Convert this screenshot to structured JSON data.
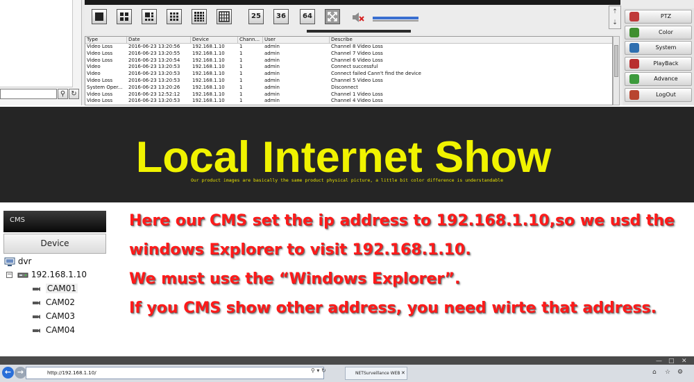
{
  "cms_screen": {
    "search": {
      "value": ""
    },
    "search_btn_icon": "magnifier-icon",
    "refresh_btn_icon": "refresh-icon",
    "layout_buttons": [
      "25",
      "36",
      "64"
    ],
    "log_table": {
      "headers": [
        "Type",
        "Date",
        "Device",
        "Chann...",
        "User",
        "Describe"
      ],
      "rows": [
        [
          "Video Loss",
          "2016-06-23 13:20:56",
          "192.168.1.10",
          "1",
          "admin",
          "Channel 8 Video Loss"
        ],
        [
          "Video Loss",
          "2016-06-23 13:20:55",
          "192.168.1.10",
          "1",
          "admin",
          "Channel 7 Video Loss"
        ],
        [
          "Video Loss",
          "2016-06-23 13:20:54",
          "192.168.1.10",
          "1",
          "admin",
          "Channel 6 Video Loss"
        ],
        [
          "Video",
          "2016-06-23 13:20:53",
          "192.168.1.10",
          "1",
          "admin",
          "Connect successful"
        ],
        [
          "Video",
          "2016-06-23 13:20:53",
          "192.168.1.10",
          "1",
          "admin",
          "Connect failed Cann't find the device"
        ],
        [
          "Video Loss",
          "2016-06-23 13:20:53",
          "192.168.1.10",
          "1",
          "admin",
          "Channel 5 Video Loss"
        ],
        [
          "System Oper...",
          "2016-06-23 13:20:26",
          "192.168.1.10",
          "1",
          "admin",
          "Disconnect"
        ],
        [
          "Video Loss",
          "2016-06-23 12:52:12",
          "192.168.1.10",
          "1",
          "admin",
          "Channel 1 Video Loss"
        ],
        [
          "Video Loss",
          "2016-06-23 13:20:53",
          "192.168.1.10",
          "1",
          "admin",
          "Channel 4 Video Loss"
        ]
      ]
    },
    "right_panel": [
      {
        "label": "PTZ",
        "icon": "ptz-icon",
        "color": "#c03a3a"
      },
      {
        "label": "Color",
        "icon": "color-icon",
        "color": "#3f8f2f"
      },
      {
        "label": "System",
        "icon": "system-icon",
        "color": "#2f6fb0"
      },
      {
        "label": "PlayBack",
        "icon": "playback-icon",
        "color": "#b83030"
      },
      {
        "label": "Advance",
        "icon": "advance-icon",
        "color": "#3c9a3c"
      },
      {
        "label": "LogOut",
        "icon": "logout-icon",
        "color": "#b8452f"
      }
    ]
  },
  "banner": {
    "title": "Local Internet Show",
    "note": "Our product images are basically the same product physical picture, a little bit color difference is understandable",
    "title_color": "#f0f300",
    "background": "#252525"
  },
  "cms_panel": {
    "header": "CMS",
    "tab": "Device",
    "tree": {
      "root": "dvr",
      "device": "192.168.1.10",
      "cameras": [
        "CAM01",
        "CAM02",
        "CAM03",
        "CAM04"
      ],
      "selected": "CAM01"
    }
  },
  "instructions": {
    "color": "#ff1a1a",
    "lines": [
      "Here our CMS set the ip address to 192.168.1.10,so we usd the",
      "windows Explorer to visit 192.168.1.10.",
      "We must use the “Windows Explorer”.",
      "If you CMS show other address, you need wirte that address."
    ]
  },
  "browser": {
    "address": "http://192.168.1.10/",
    "tab_title": "NETSurveillance WEB"
  }
}
